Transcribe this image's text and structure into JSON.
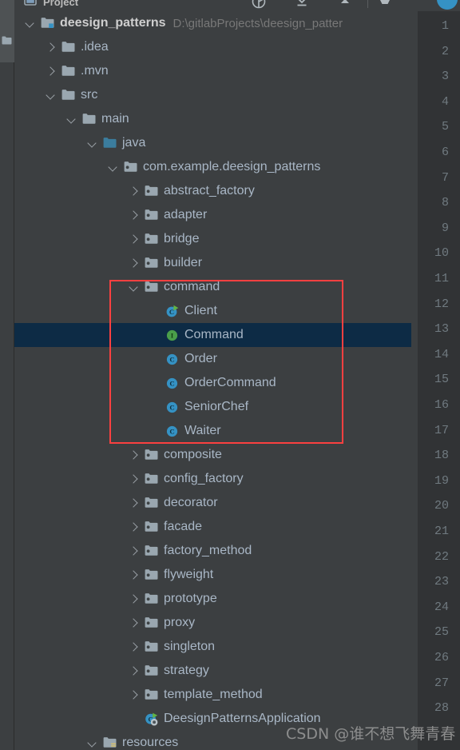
{
  "window": {
    "tool_strip_tab": "Project",
    "toolbar_title": "Project",
    "toolbar_icons": [
      "locate-icon",
      "collapse-all-icon",
      "hide-icon",
      "settings-icon"
    ]
  },
  "colors": {
    "panel_bg": "#3c3f41",
    "selection_bg": "#0d2b45",
    "text": "#a9b7c6",
    "path_text": "#787878",
    "highlight_rect": "#fb4040",
    "accent_blue": "#3592c4",
    "class_icon": "#3592c4",
    "interface_icon": "#4a9e4a",
    "gutter_bg": "#313335",
    "gutter_text": "#707a80",
    "source_root_folder": "#3b7d9e"
  },
  "tree": {
    "rows": [
      {
        "indent": 0,
        "arrow": "down",
        "icon": "module-folder-icon",
        "label": "deesign_patterns",
        "bold": true,
        "path": "D:\\gitlabProjects\\deesign_patter",
        "selected": false
      },
      {
        "indent": 1,
        "arrow": "right",
        "icon": "folder-icon",
        "label": ".idea",
        "selected": false
      },
      {
        "indent": 1,
        "arrow": "right",
        "icon": "folder-icon",
        "label": ".mvn",
        "selected": false
      },
      {
        "indent": 1,
        "arrow": "down",
        "icon": "folder-icon",
        "label": "src",
        "selected": false
      },
      {
        "indent": 2,
        "arrow": "down",
        "icon": "folder-icon",
        "label": "main",
        "selected": false
      },
      {
        "indent": 3,
        "arrow": "down",
        "icon": "source-folder-icon",
        "label": "java",
        "selected": false
      },
      {
        "indent": 4,
        "arrow": "down",
        "icon": "package-icon",
        "label": "com.example.deesign_patterns",
        "selected": false
      },
      {
        "indent": 5,
        "arrow": "right",
        "icon": "package-icon",
        "label": "abstract_factory",
        "selected": false
      },
      {
        "indent": 5,
        "arrow": "right",
        "icon": "package-icon",
        "label": "adapter",
        "selected": false
      },
      {
        "indent": 5,
        "arrow": "right",
        "icon": "package-icon",
        "label": "bridge",
        "selected": false
      },
      {
        "indent": 5,
        "arrow": "right",
        "icon": "package-icon",
        "label": "builder",
        "selected": false
      },
      {
        "indent": 5,
        "arrow": "down",
        "icon": "package-icon",
        "label": "command",
        "selected": false
      },
      {
        "indent": 6,
        "arrow": "none",
        "icon": "runnable-class-icon",
        "label": "Client",
        "selected": false
      },
      {
        "indent": 6,
        "arrow": "none",
        "icon": "interface-icon",
        "label": "Command",
        "selected": true
      },
      {
        "indent": 6,
        "arrow": "none",
        "icon": "class-icon",
        "label": "Order",
        "selected": false
      },
      {
        "indent": 6,
        "arrow": "none",
        "icon": "class-icon",
        "label": "OrderCommand",
        "selected": false
      },
      {
        "indent": 6,
        "arrow": "none",
        "icon": "class-icon",
        "label": "SeniorChef",
        "selected": false
      },
      {
        "indent": 6,
        "arrow": "none",
        "icon": "class-icon",
        "label": "Waiter",
        "selected": false
      },
      {
        "indent": 5,
        "arrow": "right",
        "icon": "package-icon",
        "label": "composite",
        "selected": false
      },
      {
        "indent": 5,
        "arrow": "right",
        "icon": "package-icon",
        "label": "config_factory",
        "selected": false
      },
      {
        "indent": 5,
        "arrow": "right",
        "icon": "package-icon",
        "label": "decorator",
        "selected": false
      },
      {
        "indent": 5,
        "arrow": "right",
        "icon": "package-icon",
        "label": "facade",
        "selected": false
      },
      {
        "indent": 5,
        "arrow": "right",
        "icon": "package-icon",
        "label": "factory_method",
        "selected": false
      },
      {
        "indent": 5,
        "arrow": "right",
        "icon": "package-icon",
        "label": "flyweight",
        "selected": false
      },
      {
        "indent": 5,
        "arrow": "right",
        "icon": "package-icon",
        "label": "prototype",
        "selected": false
      },
      {
        "indent": 5,
        "arrow": "right",
        "icon": "package-icon",
        "label": "proxy",
        "selected": false
      },
      {
        "indent": 5,
        "arrow": "right",
        "icon": "package-icon",
        "label": "singleton",
        "selected": false
      },
      {
        "indent": 5,
        "arrow": "right",
        "icon": "package-icon",
        "label": "strategy",
        "selected": false
      },
      {
        "indent": 5,
        "arrow": "right",
        "icon": "package-icon",
        "label": "template_method",
        "selected": false
      },
      {
        "indent": 5,
        "arrow": "none",
        "icon": "spring-boot-app-icon",
        "label": "DeesignPatternsApplication",
        "selected": false
      },
      {
        "indent": 3,
        "arrow": "down",
        "icon": "resources-folder-icon",
        "label": "resources",
        "selected": false
      }
    ]
  },
  "highlight": {
    "label": "command-package-highlight",
    "covers": [
      "command",
      "Client",
      "Command",
      "Order",
      "OrderCommand",
      "SeniorChef",
      "Waiter"
    ]
  },
  "gutter": {
    "lines": [
      "1",
      "2",
      "3",
      "4",
      "5",
      "6",
      "7",
      "8",
      "9",
      "10",
      "11",
      "12",
      "13",
      "14",
      "15",
      "16",
      "17",
      "18",
      "19",
      "20",
      "21",
      "22",
      "23",
      "24",
      "25",
      "26",
      "27",
      "28"
    ]
  },
  "watermark": {
    "text": "CSDN @谁不想飞舞青春"
  }
}
